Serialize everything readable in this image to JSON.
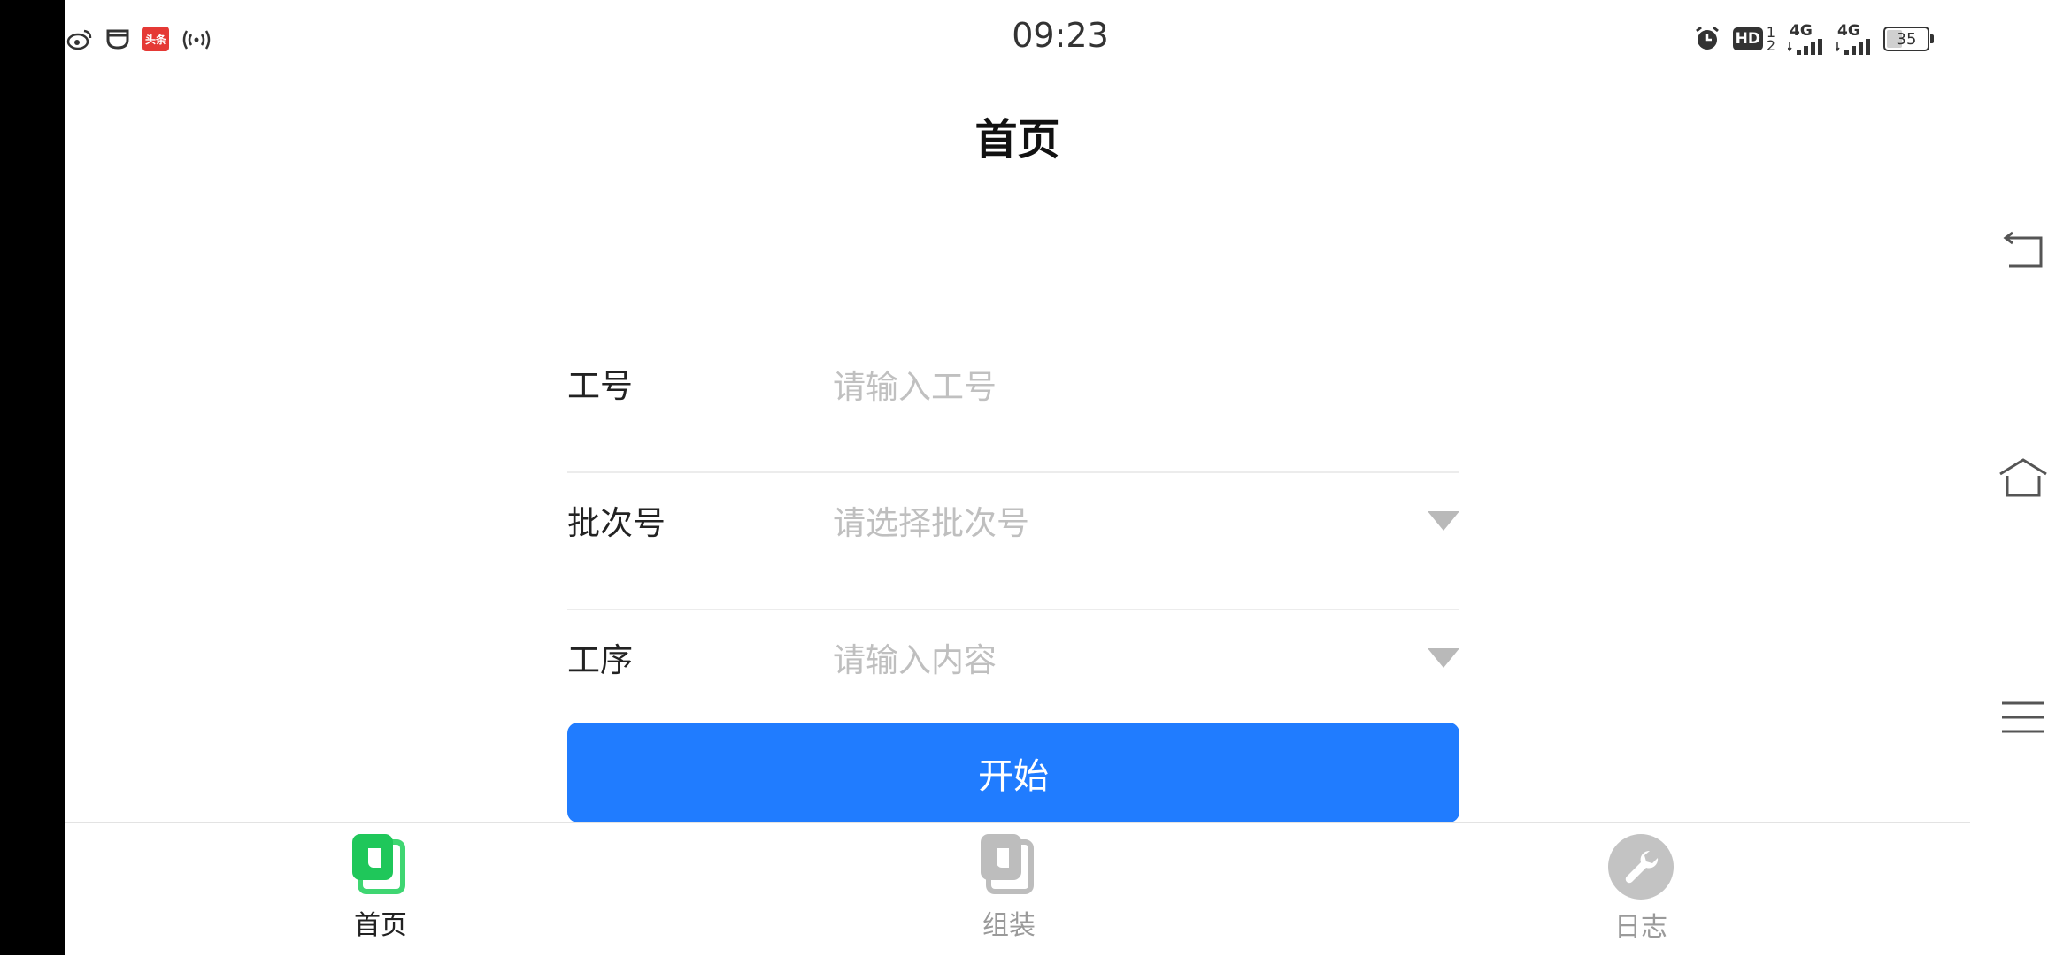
{
  "status_bar": {
    "time": "09:23",
    "left_icons": [
      "weibo-icon",
      "app-icon",
      "toutiao-icon",
      "hotspot-icon"
    ],
    "toutiao_badge": "头条",
    "hd_label": "HD",
    "hd_sims": [
      "1",
      "2"
    ],
    "network_1": "4G",
    "network_2": "4G",
    "battery": "35",
    "battery_fraction": 0.35
  },
  "header": {
    "title": "首页"
  },
  "form": {
    "rows": [
      {
        "label": "工号",
        "placeholder": "请输入工号",
        "dropdown": false
      },
      {
        "label": "批次号",
        "placeholder": "请选择批次号",
        "dropdown": true
      },
      {
        "label": "工序",
        "placeholder": "请输入内容",
        "dropdown": true
      }
    ],
    "start_label": "开始"
  },
  "tabbar": {
    "items": [
      {
        "label": "首页",
        "icon": "document-icon",
        "active": true
      },
      {
        "label": "组装",
        "icon": "document-icon",
        "active": false
      },
      {
        "label": "日志",
        "icon": "wrench-icon",
        "active": false
      }
    ]
  },
  "nav_rail": {
    "icons": [
      "back-icon",
      "home-icon",
      "menu-icon"
    ]
  },
  "colors": {
    "primary": "#207cff",
    "active_tab": "#1fc75a",
    "inactive": "#bdbdbd"
  }
}
